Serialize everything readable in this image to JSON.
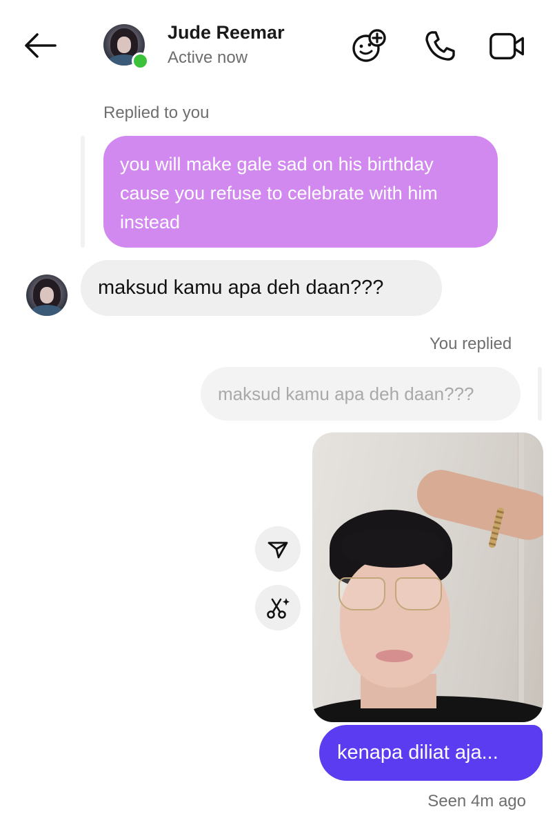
{
  "header": {
    "contact_name": "Jude Reemar",
    "status": "Active now",
    "back_icon": "arrow-left-icon",
    "icons": [
      "face-add-icon",
      "phone-icon",
      "video-camera-icon"
    ],
    "online_indicator_color": "#3cc13b"
  },
  "messages": {
    "reply_label_in": "Replied to you",
    "quoted_in_text": "you will make gale sad on his birthday cause you refuse to celebrate with him instead",
    "incoming_text": "maksud kamu apa deh daan???",
    "reply_label_out": "You replied",
    "quoted_out_text": "maksud kamu apa deh daan???",
    "outgoing_text": "kenapa diliat aja...",
    "seen_text": "Seen 4m ago"
  },
  "actions": {
    "share_icon": "send-icon",
    "edit_icon": "ai-cut-icon"
  },
  "colors": {
    "quoted_bubble": "#d189ef",
    "incoming_bubble": "#efefef",
    "outgoing_bubble": "#5b3cf0",
    "secondary_text": "#6e6e6e"
  }
}
